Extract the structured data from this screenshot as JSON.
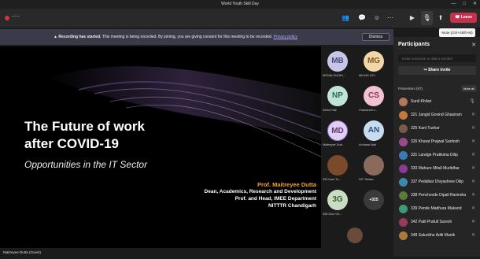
{
  "window": {
    "title": "World Youth Skill Day",
    "controls": [
      "—",
      "□",
      "✕"
    ]
  },
  "toolbar": {
    "timer": "--:--",
    "mic_tooltip": "Mute (Ctrl+Shift+M)",
    "leave_label": "Leave",
    "icons": [
      "people-icon",
      "chat-icon",
      "reactions-icon",
      "more-icon",
      "camera-icon",
      "mic-icon",
      "share-icon"
    ]
  },
  "banner": {
    "lead": "Recording has started.",
    "text": "This meeting is being recorded. By joining, you are giving consent for this meeting to be recorded.",
    "link": "Privacy policy",
    "dismiss_label": "Dismiss"
  },
  "slide": {
    "title_line1": "The Future of work",
    "title_line2": "after COVID-19",
    "subtitle": "Opportunities in the IT Sector",
    "presenter_name": "Prof. Maitreyee Dutta",
    "presenter_line1": "Dean, Academics, Research and Development",
    "presenter_line2": "Prof. and Head, IMEE Department",
    "presenter_line3": "NITTTR Chandigarh"
  },
  "speaker_label": "Maitreyee Dutta (Guest)",
  "gallery": [
    {
      "initials": "MB",
      "name": "MONALISA BH...",
      "bg": "#c8c6e8",
      "fg": "#4a4a7a"
    },
    {
      "initials": "MG",
      "name": "MILIND GO...",
      "bg": "#f3d6a8",
      "fg": "#7a5a20"
    },
    {
      "initials": "NP",
      "name": "Neha Patil",
      "bg": "#bfe5d6",
      "fg": "#2d6a55"
    },
    {
      "initials": "CS",
      "name": "Chandrani s...",
      "bg": "#f0c2d4",
      "fg": "#8a3458"
    },
    {
      "initials": "MD",
      "name": "Maitreyee Dutt...",
      "bg": "#e3cdf0",
      "fg": "#5b3a78"
    },
    {
      "initials": "AN",
      "name": "Archana Nair",
      "bg": "#c7dcef",
      "fg": "#2d4f78"
    },
    {
      "initials": "",
      "name": "325 Kant Tu...",
      "bg": "#7a4a2a",
      "fg": "#fff"
    },
    {
      "initials": "",
      "name": "NIT Tekkar...",
      "bg": "#8a6a5a",
      "fg": "#fff"
    },
    {
      "initials": "3G",
      "name": "348 Give Gh...",
      "bg": "#c9ddc5",
      "fg": "#3a5a34"
    },
    {
      "initials": "+325",
      "name": "",
      "bg": "#3a3a3a",
      "fg": "#fff"
    }
  ],
  "participants_panel": {
    "title": "Participants",
    "invite_placeholder": "Invite someone or dial a number",
    "share_invite_label": "Share invite",
    "presenters_label": "Presenters (87)",
    "mute_all_label": "Mute all",
    "people": [
      "Sunil Khilari",
      "321 Jangid Govind Ghasiram",
      "325 Kant Tushar",
      "326 Kharat Prajwal Santosh",
      "331 Landge Pratiksha Dilip",
      "333 Mahure Mitali Murlidhar",
      "337 Pedalkar Divyashree Dilip",
      "338 Penchovde Dipali Ravindra",
      "339 Pende Madhura Mukund",
      "342 Patil Prafull Suresh",
      "348 Salunkhe Aditi Manik"
    ]
  }
}
